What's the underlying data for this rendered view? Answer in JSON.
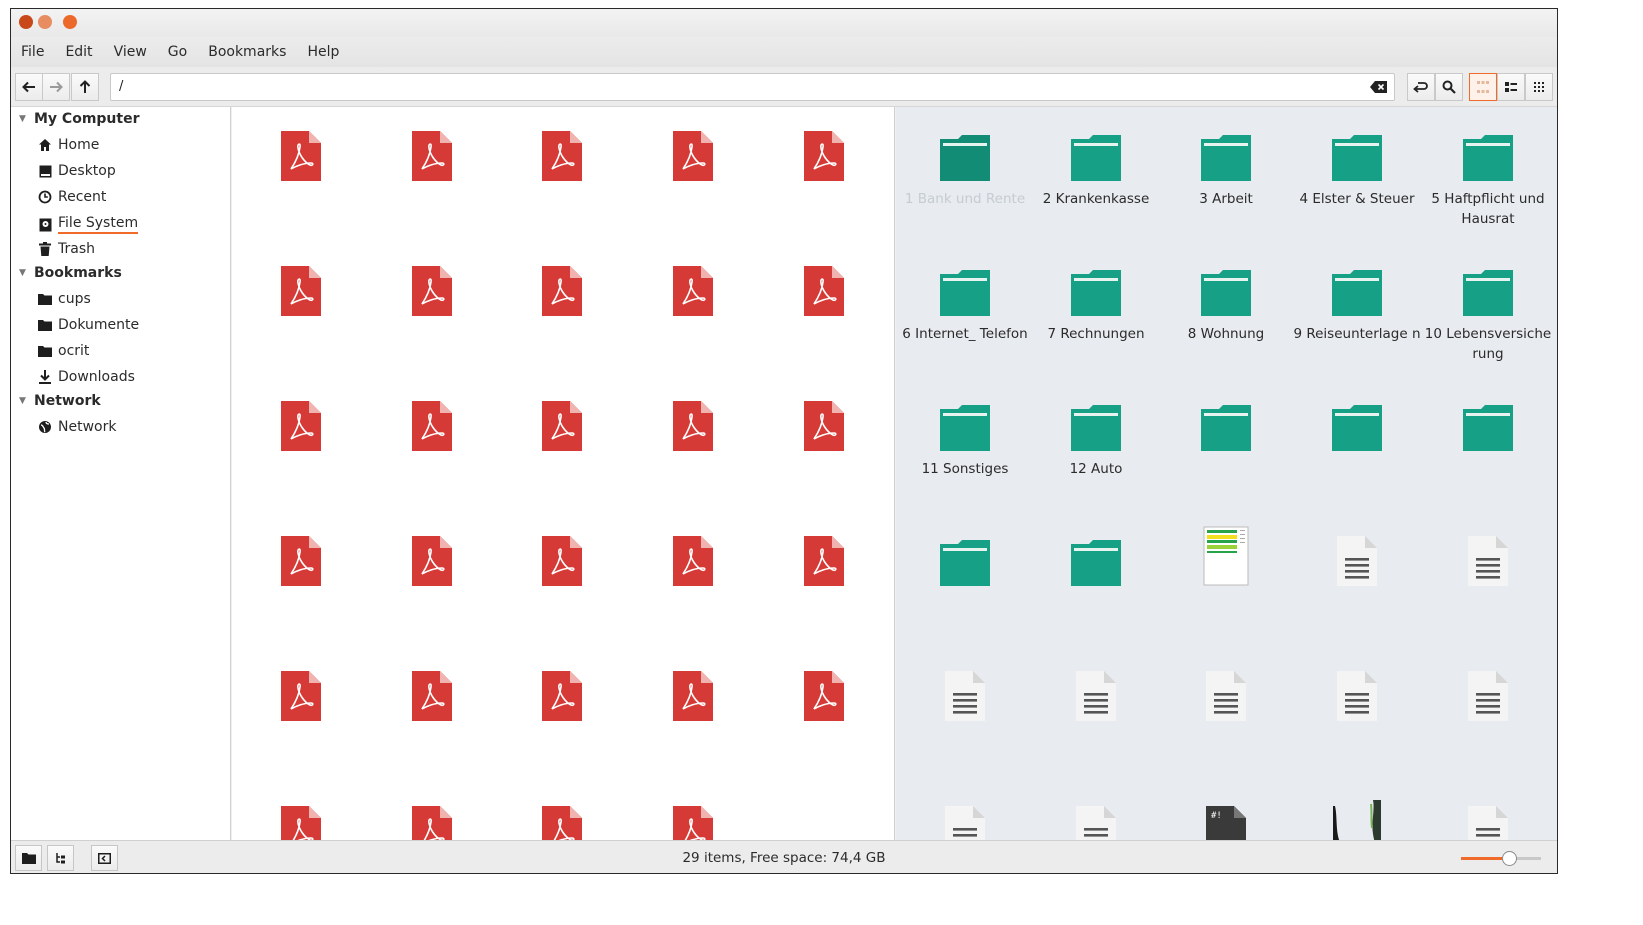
{
  "window": {
    "traffic_lights": [
      {
        "name": "close",
        "color": "#c9481a"
      },
      {
        "name": "minimize",
        "color": "#e78d61"
      },
      {
        "name": "maximize",
        "color": "#eb6a2b"
      }
    ]
  },
  "menubar": [
    "File",
    "Edit",
    "View",
    "Go",
    "Bookmarks",
    "Help"
  ],
  "toolbar": {
    "address": "/",
    "nav_icons": [
      "back-arrow-icon",
      "forward-arrow-icon",
      "up-arrow-icon"
    ],
    "right_icons": [
      "toggle-location-icon",
      "search-icon",
      "icon-view-icon",
      "list-view-icon",
      "compact-view-icon"
    ],
    "active_view": "icon-view"
  },
  "sidebar": {
    "sections": [
      {
        "title": "My Computer",
        "items": [
          {
            "label": "Home",
            "icon": "home-icon"
          },
          {
            "label": "Desktop",
            "icon": "desktop-icon"
          },
          {
            "label": "Recent",
            "icon": "clock-icon"
          },
          {
            "label": "File System",
            "icon": "drive-icon"
          },
          {
            "label": "Trash",
            "icon": "trash-icon"
          }
        ]
      },
      {
        "title": "Bookmarks",
        "items": [
          {
            "label": "cups",
            "icon": "folder-icon"
          },
          {
            "label": "Dokumente",
            "icon": "folder-icon"
          },
          {
            "label": "ocrit",
            "icon": "folder-icon"
          },
          {
            "label": "Downloads",
            "icon": "download-icon"
          }
        ]
      },
      {
        "title": "Network",
        "items": [
          {
            "label": "Network",
            "icon": "globe-icon"
          }
        ]
      }
    ]
  },
  "left_pane": {
    "file_type": "pdf",
    "rows": [
      5,
      5,
      5,
      5,
      5,
      4
    ]
  },
  "right_pane": {
    "items": [
      {
        "type": "folder",
        "label": "1 Bank und Rente",
        "faded": true
      },
      {
        "type": "folder",
        "label": "2 Krankenkasse"
      },
      {
        "type": "folder",
        "label": "3 Arbeit"
      },
      {
        "type": "folder",
        "label": "4 Elster & Steuer"
      },
      {
        "type": "folder",
        "label": "5 Haftpflicht und Hausrat"
      },
      {
        "type": "folder",
        "label": "6 Internet_ Telefon"
      },
      {
        "type": "folder",
        "label": "7 Rechnungen"
      },
      {
        "type": "folder",
        "label": "8 Wohnung"
      },
      {
        "type": "folder",
        "label": "9 Reiseunterlage n"
      },
      {
        "type": "folder",
        "label": "10 Lebensversiche rung"
      },
      {
        "type": "folder",
        "label": "11 Sonstiges"
      },
      {
        "type": "folder",
        "label": "12 Auto"
      },
      {
        "type": "folder",
        "label": ""
      },
      {
        "type": "folder",
        "label": ""
      },
      {
        "type": "folder",
        "label": ""
      },
      {
        "type": "folder",
        "label": ""
      },
      {
        "type": "folder",
        "label": ""
      },
      {
        "type": "thumbnail",
        "label": ""
      },
      {
        "type": "text",
        "label": ""
      },
      {
        "type": "text",
        "label": ""
      },
      {
        "type": "text",
        "label": ""
      },
      {
        "type": "text",
        "label": ""
      },
      {
        "type": "text",
        "label": ""
      },
      {
        "type": "text",
        "label": ""
      },
      {
        "type": "text",
        "label": ""
      },
      {
        "type": "text",
        "label": ""
      },
      {
        "type": "text",
        "label": ""
      },
      {
        "type": "script",
        "label": ""
      },
      {
        "type": "image",
        "label": ""
      },
      {
        "type": "text",
        "label": ""
      }
    ]
  },
  "statusbar": {
    "text": "29 items, Free space: 74,4 GB",
    "zoom_level": 0.6,
    "left_icons": [
      "places-icon",
      "tree-icon",
      "toggle-sidebar-icon"
    ]
  },
  "colors": {
    "accent": "#f06a2a",
    "folder": "#16a085",
    "folder_dark": "#128c74",
    "pdf": "#d63a36"
  }
}
